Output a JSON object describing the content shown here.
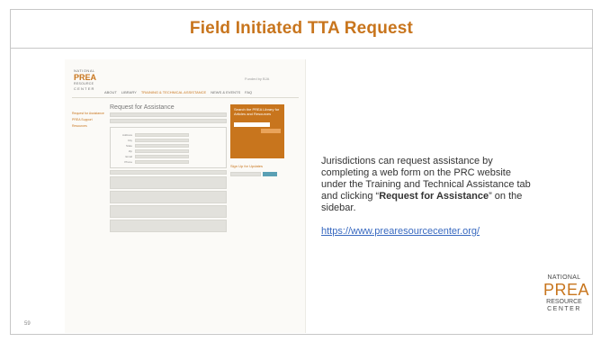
{
  "slide": {
    "title": "Field Initiated TTA Request",
    "page_number": "59",
    "body_before": "Jurisdictions can request assistance by completing a web form on the PRC website under the Training and Technical Assistance tab and clicking “",
    "body_bold": "Request for Assistance",
    "body_after": "” on the sidebar.",
    "link": "https://www.prearesourcecenter.org/",
    "brand": {
      "line1": "NATIONAL",
      "line2": "PREA",
      "line3": "RESOURCE",
      "line4": "CENTER"
    },
    "colors": {
      "title": "#c8751d",
      "link": "#3869c0",
      "accent": "#c8751d"
    }
  },
  "screenshot": {
    "logo": {
      "line1": "NATIONAL",
      "line2": "PREA",
      "line3": "RESOURCE",
      "line4": "CENTER"
    },
    "funded": "Funded by BJA",
    "nav": [
      "ABOUT",
      "LIBRARY",
      "TRAINING & TECHNICAL ASSISTANCE",
      "NEWS & EVENTS",
      "FAQ"
    ],
    "sidebar": [
      "Request for Assistance",
      "PREA Support",
      "Resources"
    ],
    "form_title": "Request for Assistance",
    "contact_fields": [
      "Address",
      "City",
      "State",
      "Zip",
      "Email",
      "Phone"
    ],
    "orange_box": "Search the PREA Library for Articles and Resources",
    "signup_title": "Sign Up for Updates"
  }
}
